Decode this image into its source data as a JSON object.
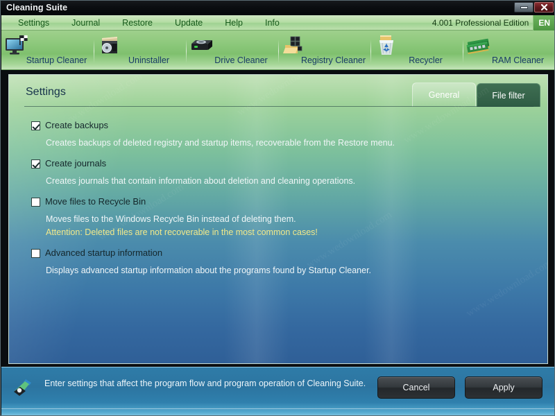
{
  "window": {
    "title": "Cleaning Suite",
    "minimize_label": "–",
    "close_label": "✕"
  },
  "menubar": {
    "items": [
      {
        "label": "Settings"
      },
      {
        "label": "Journal"
      },
      {
        "label": "Restore"
      },
      {
        "label": "Update"
      },
      {
        "label": "Help"
      },
      {
        "label": "Info"
      }
    ],
    "version": "4.001 Professional Edition",
    "language": "EN"
  },
  "toolbar": {
    "items": [
      {
        "label": "Startup Cleaner",
        "icon": "monitor-flag-icon"
      },
      {
        "label": "Uninstaller",
        "icon": "cd-box-icon"
      },
      {
        "label": "Drive Cleaner",
        "icon": "hard-drive-icon"
      },
      {
        "label": "Registry Cleaner",
        "icon": "registry-blocks-icon"
      },
      {
        "label": "Recycler",
        "icon": "recycle-bin-icon"
      },
      {
        "label": "RAM Cleaner",
        "icon": "ram-module-icon"
      }
    ]
  },
  "panel": {
    "title": "Settings",
    "tabs": [
      {
        "label": "General",
        "active": true
      },
      {
        "label": "File filter",
        "active": false
      }
    ],
    "options": [
      {
        "label": "Create backups",
        "checked": true,
        "description": "Creates backups of deleted registry and startup items, recoverable from the Restore menu.",
        "warning": ""
      },
      {
        "label": "Create journals",
        "checked": true,
        "description": "Creates journals that contain information about deletion and cleaning operations.",
        "warning": ""
      },
      {
        "label": "Move files to Recycle Bin",
        "checked": false,
        "description": "Moves files to the Windows Recycle Bin instead of deleting them.",
        "warning": "Attention: Deleted files are not recoverable in the most common cases!"
      },
      {
        "label": "Advanced startup information",
        "checked": false,
        "description": "Displays advanced startup information about the programs found by Startup Cleaner.",
        "warning": ""
      }
    ]
  },
  "statusbar": {
    "icon": "broom-icon",
    "text": "Enter settings that affect the program flow and program operation of Cleaning Suite.",
    "buttons": [
      {
        "label": "Cancel"
      },
      {
        "label": "Apply"
      }
    ]
  },
  "colors": {
    "accent_green": "#7fc06e",
    "accent_blue": "#2f7ca8",
    "warning_yellow": "#f2e98a",
    "close_red": "#61191d"
  }
}
